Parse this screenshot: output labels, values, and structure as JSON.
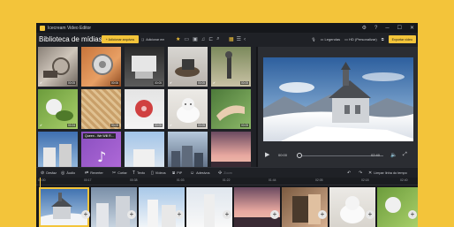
{
  "titlebar": {
    "title": "Icecream Video Editor",
    "icons": {
      "settings": "⚙",
      "help": "?",
      "minimize": "─",
      "maximize": "☐",
      "close": "✕"
    }
  },
  "header": {
    "library_title": "Biblioteca de mídias",
    "add_media_label": "+ Adicionar arquivos",
    "add_from_label": "Adicionar em",
    "subtitles_label": "Legendas",
    "resolution_label": "HD (Personalizar)",
    "export_label": "Exportar vídeo"
  },
  "media": [
    {
      "duration": "00:05",
      "checked": true
    },
    {
      "duration": "00:06",
      "checked": false
    },
    {
      "duration": "00:05",
      "checked": false
    },
    {
      "duration": "00:05",
      "checked": true
    },
    {
      "duration": "00:05",
      "checked": true
    },
    {
      "duration": "00:24",
      "checked": true
    },
    {
      "duration": "00:05",
      "checked": false
    },
    {
      "duration": "00:05",
      "checked": true
    },
    {
      "duration": "00:05",
      "checked": true
    },
    {
      "duration": "00:05",
      "checked": false
    },
    {
      "duration": "",
      "checked": false,
      "tooltip": "Queen - We Will R..."
    },
    {
      "duration": "",
      "checked": false
    }
  ],
  "player": {
    "time_current": "00:00",
    "time_total": "02:40"
  },
  "toolbar": {
    "undo_label": "Desfaz",
    "audio_label": "Áudio",
    "reverse_label": "Reverter",
    "cut_label": "Cortar",
    "text_label": "Texto",
    "video_label": "Vídeos",
    "pip_label": "PiP",
    "stickers_label": "Adesivos",
    "zoom_label": "Zoom",
    "clear_label": "Limpar linha do tempo"
  },
  "ruler": {
    "marks": [
      "00:00",
      "00:17",
      "00:38",
      "01:03",
      "01:22",
      "01:44",
      "02:05",
      "02:18",
      "02:40"
    ]
  },
  "colors": {
    "accent": "#f3c43a",
    "window": "#1f2126",
    "titlebar": "#15171b"
  }
}
